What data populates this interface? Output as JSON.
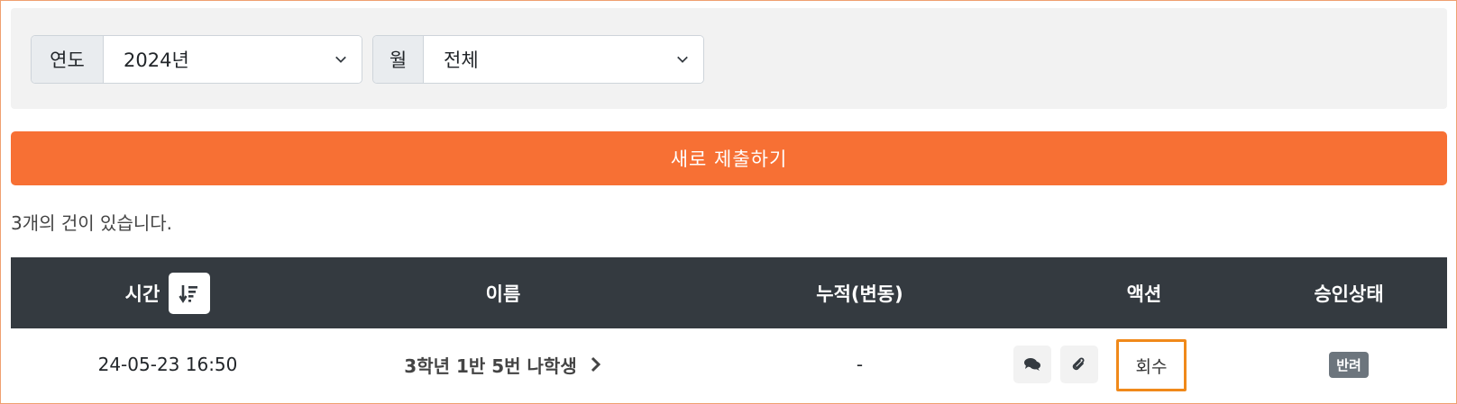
{
  "filters": {
    "year_label": "연도",
    "year_value": "2024년",
    "month_label": "월",
    "month_value": "전체"
  },
  "actions": {
    "submit_label": "새로 제출하기"
  },
  "summary": {
    "count_text": "3개의 건이 있습니다."
  },
  "table": {
    "headers": {
      "time": "시간",
      "name": "이름",
      "accumulated": "누적(변동)",
      "action": "액션",
      "status": "승인상태"
    },
    "rows": [
      {
        "time": "24-05-23 16:50",
        "name": "3학년 1반 5번 나학생",
        "accumulated": "-",
        "recall_label": "회수",
        "status": "반려"
      }
    ]
  },
  "icons": {
    "sort": "sort-desc-icon",
    "comment": "comments-icon",
    "attach": "paperclip-icon",
    "chevron": "chevron-right-icon",
    "dropdown": "chevron-down-icon"
  },
  "colors": {
    "accent": "#f77034",
    "header_bg": "#343a40",
    "highlight": "#f0891a",
    "badge_bg": "#6c757d"
  }
}
